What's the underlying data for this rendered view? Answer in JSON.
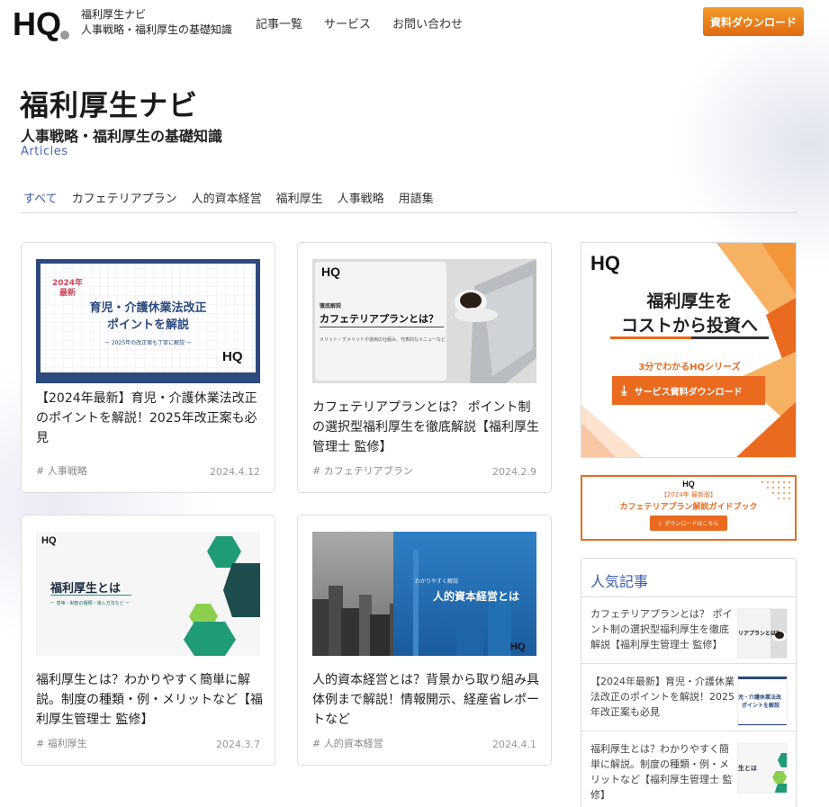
{
  "header": {
    "logo_text": "HQ",
    "site_name": "福利厚生ナビ",
    "site_tagline": "人事戦略・福利厚生の基礎知識",
    "nav": [
      "記事一覧",
      "サービス",
      "お問い合わせ"
    ],
    "cta_label": "資料ダウンロード"
  },
  "hero": {
    "title": "福利厚生ナビ",
    "subtitle": "人事戦略・福利厚生の基礎知識",
    "articles_label": "Articles"
  },
  "tabs": [
    "すべて",
    "カフェテリアプラン",
    "人的資本経営",
    "福利厚生",
    "人事戦略",
    "用語集"
  ],
  "cards": [
    {
      "thumb": {
        "badge_year": "2024年",
        "badge_new": "最新",
        "line1": "育児・介護休業法改正",
        "line2": "ポイントを解説",
        "line3": "ー 2025年の改正案も丁寧に解説 ー",
        "logo": "HQ"
      },
      "title": "【2024年最新】育児・介護休業法改正のポイントを解説！2025年改正案も必見",
      "tag": "# 人事戦略",
      "date": "2024.4.12"
    },
    {
      "thumb": {
        "logo": "HQ",
        "kicker": "徹底解説",
        "heading": "カフェテリアプランとは？",
        "caption": "メリット・デメリットや運用の仕組み、代表的なメニューなど"
      },
      "title": "カフェテリアプランとは？ ポイント制の選択型福利厚生を徹底解説【福利厚生管理士 監修】",
      "tag": "# カフェテリアプラン",
      "date": "2024.2.9"
    },
    {
      "thumb": {
        "logo": "HQ",
        "heading": "福利厚生とは",
        "caption": "ー 意味・制度の種類・導入方法など ー"
      },
      "title": "福利厚生とは？わかりやすく簡単に解説。制度の種類・例・メリットなど【福利厚生管理士 監修】",
      "tag": "# 福利厚生",
      "date": "2024.3.7"
    },
    {
      "thumb": {
        "kicker": "わかりやすく解説",
        "heading": "人的資本経営とは",
        "logo": "HQ"
      },
      "title": "人的資本経営とは？背景から取り組み具体例まで解説！情報開示、経産省レポートなど",
      "tag": "# 人的資本経営",
      "date": "2024.4.1"
    }
  ],
  "ad1": {
    "logo": "HQ",
    "line1": "福利厚生を",
    "line2": "コストから投資へ",
    "sub": "3分でわかるHQシリーズ",
    "button": "サービス資料ダウンロード"
  },
  "ad2": {
    "logo": "HQ",
    "edition": "【2024年 最新版】",
    "title": "カフェテリアプラン解説ガイドブック",
    "button": "ダウンロードはこちら"
  },
  "popular": {
    "heading": "人気記事",
    "items": [
      {
        "text": "カフェテリアプランとは？ ポイント制の選択型福利厚生を徹底解説【福利厚生管理士 監修】",
        "thumb_text": "リアプランとは？"
      },
      {
        "text": "【2024年最新】育児・介護休業法改正のポイントを解説！2025年改正案も必見",
        "thumb_text1": "児・介護休業法改",
        "thumb_text2": "ポイントを解説"
      },
      {
        "text": "福利厚生とは？わかりやすく簡単に解説。制度の種類・例・メリットなど【福利厚生管理士 監修】",
        "thumb_text": "生とは"
      }
    ]
  },
  "colors": {
    "accent_blue": "#3a5bb0",
    "cta_orange": "#e8761a",
    "card_navy": "#2c4a7e",
    "teal": "#1f9b76"
  }
}
